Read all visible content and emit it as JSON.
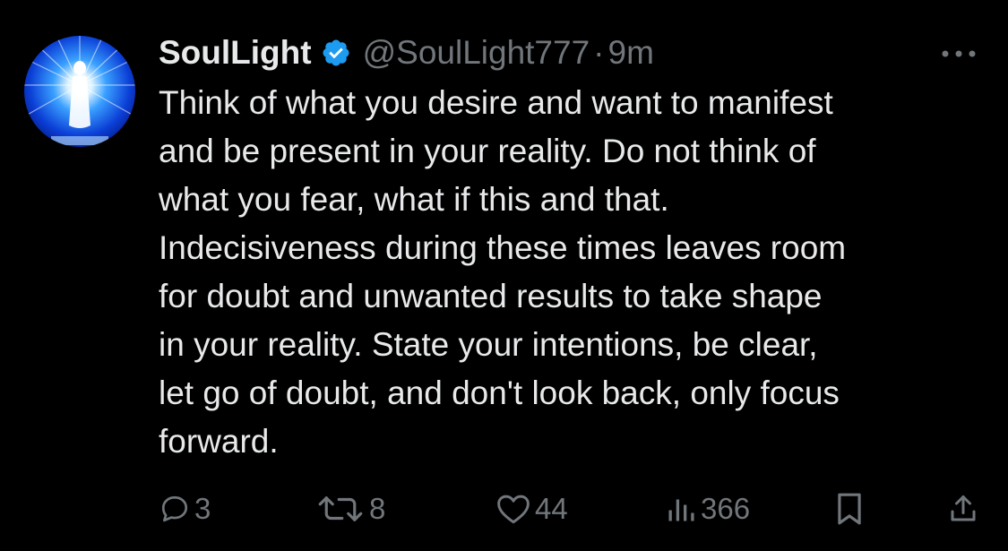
{
  "tweet": {
    "author": {
      "display_name": "SoulLight",
      "handle": "@SoulLight777",
      "verified": true,
      "avatar_icon": "glowing-figure-avatar"
    },
    "separator": "·",
    "time": "9m",
    "body": "Think of what you desire and want to manifest\nand be present in your reality. Do not think of\nwhat you fear, what if this and that.\nIndecisiveness during these times leaves room\nfor doubt and unwanted results to take shape\nin your reality. State your intentions, be clear,\nlet go of doubt, and don't look back, only focus\nforward.",
    "actions": {
      "reply_count": "3",
      "retweet_count": "8",
      "like_count": "44",
      "views_count": "366"
    }
  },
  "colors": {
    "background": "#000000",
    "text_primary": "#e7e9ea",
    "text_secondary": "#71767b",
    "verified_badge": "#1d9bf0"
  },
  "icons": {
    "more": "more-horizontal-icon",
    "reply": "reply-bubble-icon",
    "retweet": "retweet-icon",
    "like": "heart-icon",
    "views": "views-bar-chart-icon",
    "bookmark": "bookmark-icon",
    "share": "share-icon"
  }
}
